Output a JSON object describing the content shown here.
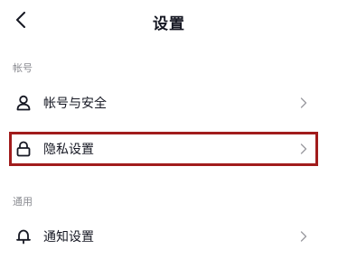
{
  "nav": {
    "title": "设置",
    "back_icon": "chevron-left-icon"
  },
  "sections": [
    {
      "header": "帐号",
      "items": [
        {
          "label": "帐号与安全",
          "icon": "user-icon",
          "highlighted": false
        },
        {
          "label": "隐私设置",
          "icon": "lock-icon",
          "highlighted": true
        }
      ]
    },
    {
      "header": "通用",
      "items": [
        {
          "label": "通知设置",
          "icon": "bell-icon",
          "highlighted": false
        }
      ]
    }
  ],
  "colors": {
    "text": "#161823",
    "secondary_text": "#8a8b91",
    "chevron": "#9a9ba0",
    "highlight_border": "#a11c1c"
  }
}
